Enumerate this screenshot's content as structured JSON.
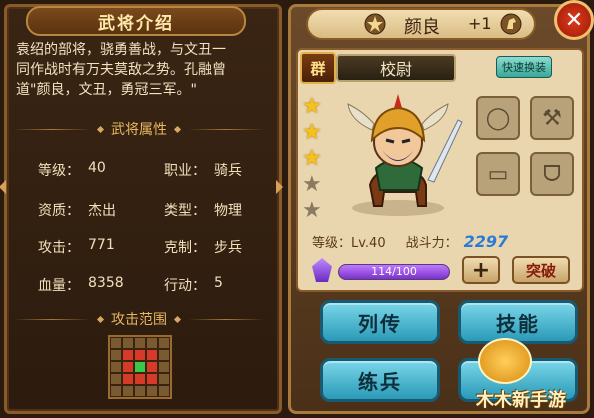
{
  "colors": {
    "accent_gold": "#e8b860",
    "button_teal": "#2a9ab8",
    "power_blue": "#2a7ad8",
    "star_gold": "#f6c21a"
  },
  "left": {
    "title": "武将介绍",
    "bio_lines": [
      "袁绍的部将，骁勇善战，与文丑一",
      "同作战时有万夫莫敌之势。孔融曾",
      "道\"颜良，文丑，勇冠三军。\""
    ],
    "attributes_header": "武将属性",
    "stats": [
      {
        "label": "等级：",
        "value": "40"
      },
      {
        "label": "职业：",
        "value": "骑兵"
      },
      {
        "label": "资质：",
        "value": "杰出"
      },
      {
        "label": "类型：",
        "value": "物理"
      },
      {
        "label": "攻击：",
        "value": "771"
      },
      {
        "label": "克制：",
        "value": "步兵"
      },
      {
        "label": "血量：",
        "value": "8358"
      },
      {
        "label": "行动：",
        "value": "5"
      }
    ],
    "range_header": "攻击范围"
  },
  "right": {
    "name": "颜良",
    "plus_level": "+1",
    "faction": "群",
    "rank": "校尉",
    "quick_equip_label": "快速换装",
    "stars_total": 5,
    "stars_filled": 3,
    "level_label": "等级：Lv.40",
    "power_label": "战斗力：",
    "power_value": "2297",
    "xp_text": "114/100",
    "xp_fraction": 1.0,
    "plus_symbol": "+",
    "breakthrough_label": "突破",
    "buttons": {
      "biography": "列传",
      "skills": "技能",
      "training": "练兵",
      "other": ""
    },
    "equip_icons": [
      "ring-icon",
      "axe-icon",
      "scroll-icon",
      "necklace-icon"
    ]
  },
  "watermark": "木木新手游"
}
